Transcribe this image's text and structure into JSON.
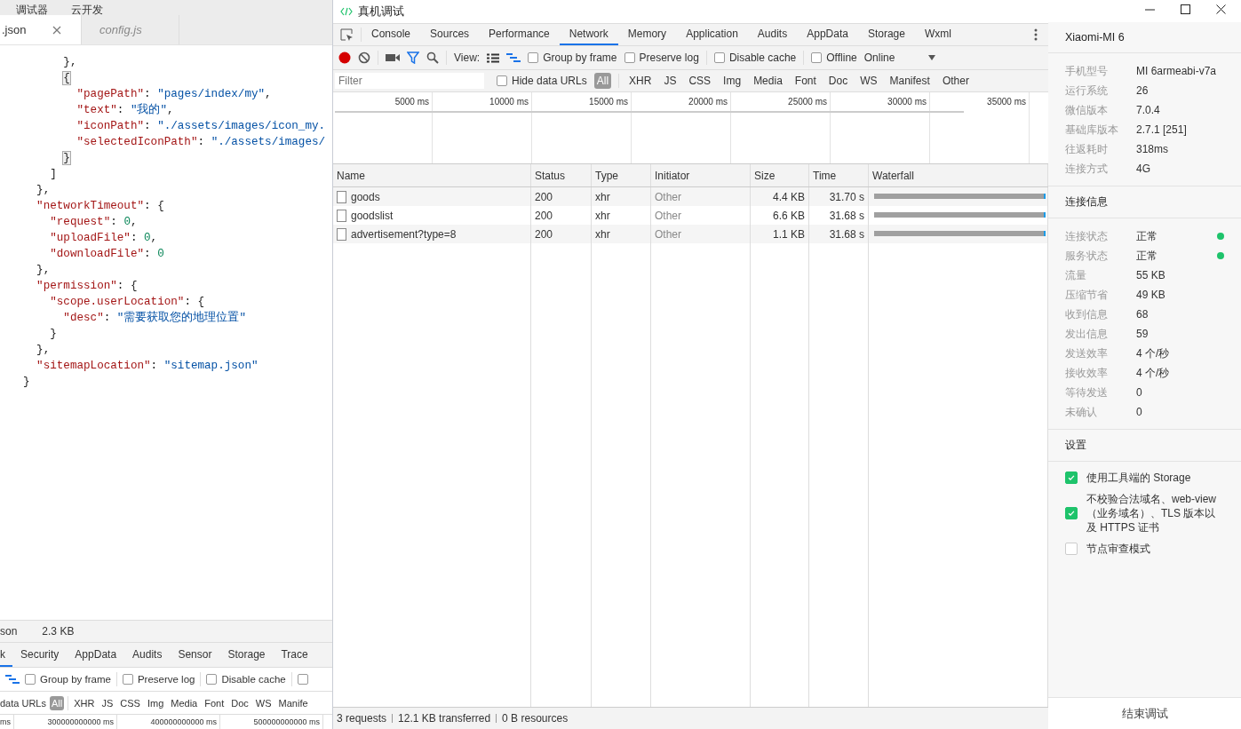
{
  "editor": {
    "menu": [
      "调试器",
      "云开发"
    ],
    "tabs": [
      {
        "label": ".json",
        "selected": true,
        "closable": true
      },
      {
        "label": "config.js",
        "selected": false,
        "closable": false
      }
    ],
    "code": [
      {
        "children": [
          {
            "children": [
              {
                "children": [
                  {
                    "parts": [
                      {
                        "kind": "punct",
                        "text": "},"
                      }
                    ]
                  },
                  {
                    "parts": [
                      {
                        "kind": "match",
                        "text": "{"
                      }
                    ],
                    "children": [
                      {
                        "parts": [
                          {
                            "kind": "key",
                            "text": "\"pagePath\""
                          },
                          {
                            "kind": "punct",
                            "text": ": "
                          },
                          {
                            "kind": "string",
                            "text": "\"pages/index/my\""
                          },
                          {
                            "kind": "punct",
                            "text": ","
                          }
                        ]
                      },
                      {
                        "parts": [
                          {
                            "kind": "key",
                            "text": "\"text\""
                          },
                          {
                            "kind": "punct",
                            "text": ": "
                          },
                          {
                            "kind": "string",
                            "text": "\"我的\""
                          },
                          {
                            "kind": "punct",
                            "text": ","
                          }
                        ]
                      },
                      {
                        "parts": [
                          {
                            "kind": "key",
                            "text": "\"iconPath\""
                          },
                          {
                            "kind": "punct",
                            "text": ": "
                          },
                          {
                            "kind": "string",
                            "text": "\"./assets/images/icon_my."
                          }
                        ]
                      },
                      {
                        "parts": [
                          {
                            "kind": "key",
                            "text": "\"selectedIconPath\""
                          },
                          {
                            "kind": "punct",
                            "text": ": "
                          },
                          {
                            "kind": "string",
                            "text": "\"./assets/images/"
                          }
                        ]
                      }
                    ]
                  },
                  {
                    "parts": [
                      {
                        "kind": "match",
                        "text": "}"
                      }
                    ]
                  }
                ]
              },
              {
                "parts": [
                  {
                    "kind": "punct",
                    "text": "]"
                  }
                ]
              }
            ]
          },
          {
            "parts": [
              {
                "kind": "punct",
                "text": "},"
              }
            ]
          },
          {
            "parts": [
              {
                "kind": "key",
                "text": "\"networkTimeout\""
              },
              {
                "kind": "punct",
                "text": ": {"
              }
            ],
            "children": [
              {
                "parts": [
                  {
                    "kind": "key",
                    "text": "\"request\""
                  },
                  {
                    "kind": "punct",
                    "text": ": "
                  },
                  {
                    "kind": "number",
                    "text": "0"
                  },
                  {
                    "kind": "punct",
                    "text": ","
                  }
                ]
              },
              {
                "parts": [
                  {
                    "kind": "key",
                    "text": "\"uploadFile\""
                  },
                  {
                    "kind": "punct",
                    "text": ": "
                  },
                  {
                    "kind": "number",
                    "text": "0"
                  },
                  {
                    "kind": "punct",
                    "text": ","
                  }
                ]
              },
              {
                "parts": [
                  {
                    "kind": "key",
                    "text": "\"downloadFile\""
                  },
                  {
                    "kind": "punct",
                    "text": ": "
                  },
                  {
                    "kind": "number",
                    "text": "0"
                  }
                ]
              }
            ]
          },
          {
            "parts": [
              {
                "kind": "punct",
                "text": "},"
              }
            ]
          },
          {
            "parts": [
              {
                "kind": "key",
                "text": "\"permission\""
              },
              {
                "kind": "punct",
                "text": ": {"
              }
            ],
            "children": [
              {
                "parts": [
                  {
                    "kind": "key",
                    "text": "\"scope.userLocation\""
                  },
                  {
                    "kind": "punct",
                    "text": ": {"
                  }
                ],
                "children": [
                  {
                    "parts": [
                      {
                        "kind": "key",
                        "text": "\"desc\""
                      },
                      {
                        "kind": "punct",
                        "text": ": "
                      },
                      {
                        "kind": "string",
                        "text": "\"需要获取您的地理位置\""
                      }
                    ]
                  }
                ]
              },
              {
                "parts": [
                  {
                    "kind": "punct",
                    "text": "}"
                  }
                ]
              }
            ]
          },
          {
            "parts": [
              {
                "kind": "punct",
                "text": "},"
              }
            ]
          },
          {
            "parts": [
              {
                "kind": "key",
                "text": "\"sitemapLocation\""
              },
              {
                "kind": "punct",
                "text": ": "
              },
              {
                "kind": "string",
                "text": "\"sitemap.json\""
              }
            ]
          }
        ]
      },
      {
        "parts": [
          {
            "kind": "punct",
            "text": "}"
          }
        ]
      }
    ],
    "status": {
      "file": "son",
      "size": "2.3 KB"
    },
    "devtools": {
      "tabs": [
        {
          "label": "k",
          "selected": true
        },
        {
          "label": "Security",
          "selected": false
        },
        {
          "label": "AppData",
          "selected": false
        },
        {
          "label": "Audits",
          "selected": false
        },
        {
          "label": "Sensor",
          "selected": false
        },
        {
          "label": "Storage",
          "selected": false
        },
        {
          "label": "Trace",
          "selected": false
        }
      ],
      "checkboxes": [
        {
          "label": "Group by frame",
          "checked": false
        },
        {
          "label": "Preserve log",
          "checked": false
        },
        {
          "label": "Disable cache",
          "checked": false
        }
      ],
      "cut_checkbox": {
        "checked": false
      },
      "hide_label": "data URLs",
      "filter_types": [
        {
          "label": "All",
          "selected": true
        },
        {
          "label": "XHR",
          "selected": false
        },
        {
          "label": "JS",
          "selected": false
        },
        {
          "label": "CSS",
          "selected": false
        },
        {
          "label": "Img",
          "selected": false
        },
        {
          "label": "Media",
          "selected": false
        },
        {
          "label": "Font",
          "selected": false
        },
        {
          "label": "Doc",
          "selected": false
        },
        {
          "label": "WS",
          "selected": false
        },
        {
          "label": "Manife",
          "selected": false
        }
      ],
      "ticks": [
        "ms",
        "300000000000 ms",
        "400000000000 ms",
        "500000000000 ms"
      ]
    }
  },
  "window": {
    "title": "真机调试"
  },
  "network": {
    "tabs": [
      {
        "label": "Console",
        "selected": false
      },
      {
        "label": "Sources",
        "selected": false
      },
      {
        "label": "Performance",
        "selected": false
      },
      {
        "label": "Network",
        "selected": true
      },
      {
        "label": "Memory",
        "selected": false
      },
      {
        "label": "Application",
        "selected": false
      },
      {
        "label": "Audits",
        "selected": false
      },
      {
        "label": "AppData",
        "selected": false
      },
      {
        "label": "Storage",
        "selected": false
      },
      {
        "label": "Wxml",
        "selected": false
      }
    ],
    "view_label": "View:",
    "checkboxes": [
      {
        "label": "Group by frame",
        "checked": false
      },
      {
        "label": "Preserve log",
        "checked": false
      },
      {
        "label": "Disable cache",
        "checked": false
      },
      {
        "label": "Offline",
        "checked": false
      }
    ],
    "throttling": "Online",
    "filter": {
      "placeholder": "Filter"
    },
    "hide_data_urls": {
      "label": "Hide data URLs",
      "checked": false
    },
    "filter_types": [
      {
        "label": "All",
        "selected": true
      },
      {
        "label": "XHR",
        "selected": false
      },
      {
        "label": "JS",
        "selected": false
      },
      {
        "label": "CSS",
        "selected": false
      },
      {
        "label": "Img",
        "selected": false
      },
      {
        "label": "Media",
        "selected": false
      },
      {
        "label": "Font",
        "selected": false
      },
      {
        "label": "Doc",
        "selected": false
      },
      {
        "label": "WS",
        "selected": false
      },
      {
        "label": "Manifest",
        "selected": false
      },
      {
        "label": "Other",
        "selected": false
      }
    ],
    "ticks": [
      "5000 ms",
      "10000 ms",
      "15000 ms",
      "20000 ms",
      "25000 ms",
      "30000 ms",
      "35000 ms"
    ],
    "columns": [
      "Name",
      "Status",
      "Type",
      "Initiator",
      "Size",
      "Time",
      "Waterfall"
    ],
    "rows": [
      {
        "name": "goods",
        "status": "200",
        "type": "xhr",
        "initiator": "Other",
        "size": "4.4 KB",
        "time": "31.70 s"
      },
      {
        "name": "goodslist",
        "status": "200",
        "type": "xhr",
        "initiator": "Other",
        "size": "6.6 KB",
        "time": "31.68 s"
      },
      {
        "name": "advertisement?type=8",
        "status": "200",
        "type": "xhr",
        "initiator": "Other",
        "size": "1.1 KB",
        "time": "31.68 s"
      }
    ],
    "status_bar": [
      "3 requests",
      "12.1 KB transferred",
      "0 B resources"
    ]
  },
  "device": {
    "title": "Xiaomi-MI 6",
    "info": [
      {
        "label": "手机型号",
        "value": "MI 6armeabi-v7a"
      },
      {
        "label": "运行系统",
        "value": "26"
      },
      {
        "label": "微信版本",
        "value": "7.0.4"
      },
      {
        "label": "基础库版本",
        "value": "2.7.1 [251]"
      },
      {
        "label": "往返耗时",
        "value": "318ms"
      },
      {
        "label": "连接方式",
        "value": "4G"
      }
    ],
    "connection_title": "连接信息",
    "connection": [
      {
        "label": "连接状态",
        "value": "正常",
        "color": "#1ec36b"
      },
      {
        "label": "服务状态",
        "value": "正常",
        "color": "#1ec36b"
      },
      {
        "label": "流量",
        "value": "55 KB"
      },
      {
        "label": "压缩节省",
        "value": "49 KB"
      },
      {
        "label": "收到信息",
        "value": "68"
      },
      {
        "label": "发出信息",
        "value": "59"
      },
      {
        "label": "发送效率",
        "value": "4 个/秒"
      },
      {
        "label": "接收效率",
        "value": "4 个/秒"
      },
      {
        "label": "等待发送",
        "value": "0"
      },
      {
        "label": "未确认",
        "value": "0"
      }
    ],
    "settings_title": "设置",
    "settings": [
      {
        "label": "使用工具端的 Storage",
        "checked": true
      },
      {
        "label": "不校验合法域名、web-view（业务域名）、TLS 版本以及 HTTPS 证书",
        "checked": true
      },
      {
        "label": "节点审查模式",
        "checked": false
      }
    ],
    "end_button": "结束调试"
  }
}
